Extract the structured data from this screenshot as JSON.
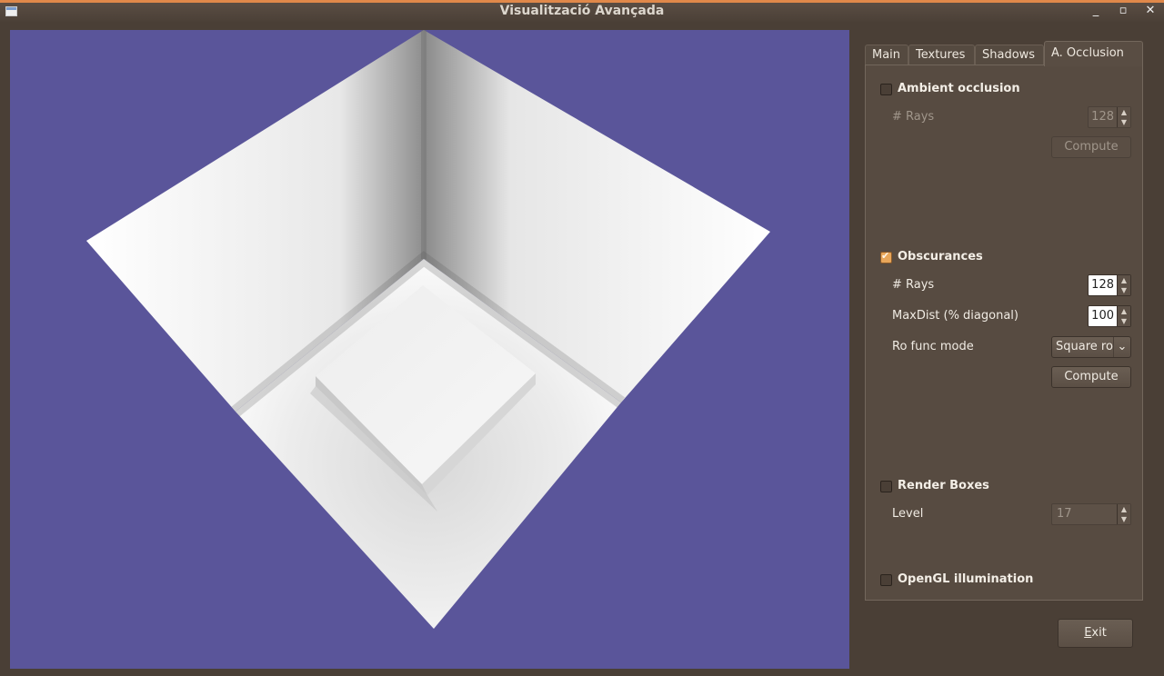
{
  "window": {
    "title": "Visualització Avançada",
    "controls": {
      "minimize": "_",
      "maximize": "▫",
      "close": "✕"
    }
  },
  "tabs": [
    {
      "label": "Main",
      "active": false
    },
    {
      "label": "Textures",
      "active": false
    },
    {
      "label": "Shadows",
      "active": false
    },
    {
      "label": "A. Occlusion",
      "active": true
    }
  ],
  "ambient_occlusion": {
    "label": "Ambient occlusion",
    "checked": false,
    "rays_label": "# Rays",
    "rays_value": "128",
    "compute_label": "Compute"
  },
  "obscurances": {
    "label": "Obscurances",
    "checked": true,
    "rays_label": "# Rays",
    "rays_value": "128",
    "maxdist_label": "MaxDist (% diagonal)",
    "maxdist_value": "100",
    "rofunc_label": "Ro func mode",
    "rofunc_value": "Square ro",
    "compute_label": "Compute"
  },
  "render_boxes": {
    "label": "Render Boxes",
    "checked": false,
    "level_label": "Level",
    "level_value": "17"
  },
  "opengl": {
    "label": "OpenGL illumination",
    "checked": false
  },
  "exit": {
    "mnemonic": "E",
    "rest": "xit"
  },
  "colors": {
    "viewport_bg": "#5a559a",
    "window_bg": "#4a3f36",
    "accent": "#e0884a"
  }
}
